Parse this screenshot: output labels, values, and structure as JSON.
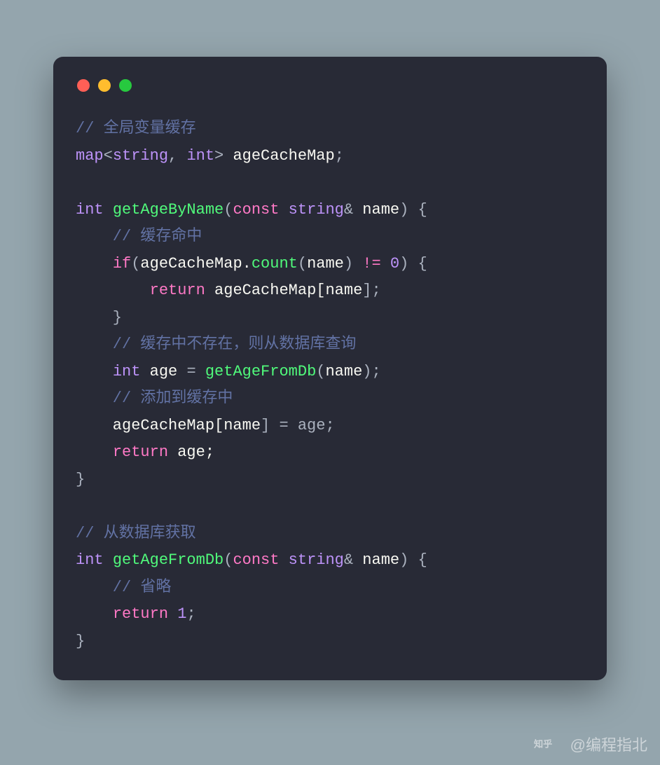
{
  "code": {
    "tokens": [
      [
        [
          "// 全局变量缓存",
          "c-comment"
        ]
      ],
      [
        [
          "map",
          "c-type"
        ],
        [
          "<",
          "c-punc"
        ],
        [
          "string",
          "c-type"
        ],
        [
          ", ",
          "c-punc"
        ],
        [
          "int",
          "c-type"
        ],
        [
          "> ",
          "c-punc"
        ],
        [
          "ageCacheMap",
          "c-var"
        ],
        [
          ";",
          "c-punc"
        ]
      ],
      [
        [
          "",
          "c-punc"
        ]
      ],
      [
        [
          "int ",
          "c-type"
        ],
        [
          "getAgeByName",
          "c-func"
        ],
        [
          "(",
          "c-punc"
        ],
        [
          "const ",
          "c-keyword"
        ],
        [
          "string",
          "c-type"
        ],
        [
          "& ",
          "c-punc"
        ],
        [
          "name",
          "c-var"
        ],
        [
          ") {",
          "c-punc"
        ]
      ],
      [
        [
          "    // 缓存命中",
          "c-comment"
        ]
      ],
      [
        [
          "    ",
          "c-punc"
        ],
        [
          "if",
          "c-keyword"
        ],
        [
          "(",
          "c-punc"
        ],
        [
          "ageCacheMap.",
          "c-var"
        ],
        [
          "count",
          "c-func"
        ],
        [
          "(",
          "c-punc"
        ],
        [
          "name",
          "c-var"
        ],
        [
          ") ",
          "c-punc"
        ],
        [
          "!=",
          "c-keyword"
        ],
        [
          " ",
          "c-punc"
        ],
        [
          "0",
          "c-num"
        ],
        [
          ") {",
          "c-punc"
        ]
      ],
      [
        [
          "        ",
          "c-punc"
        ],
        [
          "return ",
          "c-keyword"
        ],
        [
          "ageCacheMap[",
          "c-var"
        ],
        [
          "name",
          "c-var"
        ],
        [
          "];",
          "c-punc"
        ]
      ],
      [
        [
          "    }",
          "c-punc"
        ]
      ],
      [
        [
          "    // 缓存中不存在，则从数据库查询",
          "c-comment"
        ]
      ],
      [
        [
          "    ",
          "c-punc"
        ],
        [
          "int ",
          "c-type"
        ],
        [
          "age ",
          "c-var"
        ],
        [
          "= ",
          "c-punc"
        ],
        [
          "getAgeFromDb",
          "c-func"
        ],
        [
          "(",
          "c-punc"
        ],
        [
          "name",
          "c-var"
        ],
        [
          ");",
          "c-punc"
        ]
      ],
      [
        [
          "    // 添加到缓存中",
          "c-comment"
        ]
      ],
      [
        [
          "    ageCacheMap[",
          "c-var"
        ],
        [
          "name",
          "c-var"
        ],
        [
          "] = age;",
          "c-punc"
        ]
      ],
      [
        [
          "    ",
          "c-punc"
        ],
        [
          "return ",
          "c-keyword"
        ],
        [
          "age;",
          "c-var"
        ]
      ],
      [
        [
          "}",
          "c-punc"
        ]
      ],
      [
        [
          "",
          "c-punc"
        ]
      ],
      [
        [
          "// 从数据库获取",
          "c-comment"
        ]
      ],
      [
        [
          "int ",
          "c-type"
        ],
        [
          "getAgeFromDb",
          "c-func"
        ],
        [
          "(",
          "c-punc"
        ],
        [
          "const ",
          "c-keyword"
        ],
        [
          "string",
          "c-type"
        ],
        [
          "& ",
          "c-punc"
        ],
        [
          "name",
          "c-var"
        ],
        [
          ") {",
          "c-punc"
        ]
      ],
      [
        [
          "    // 省略",
          "c-comment"
        ]
      ],
      [
        [
          "    ",
          "c-punc"
        ],
        [
          "return ",
          "c-keyword"
        ],
        [
          "1",
          "c-num"
        ],
        [
          ";",
          "c-punc"
        ]
      ],
      [
        [
          "}",
          "c-punc"
        ]
      ]
    ]
  },
  "watermark": {
    "text": "@编程指北"
  }
}
